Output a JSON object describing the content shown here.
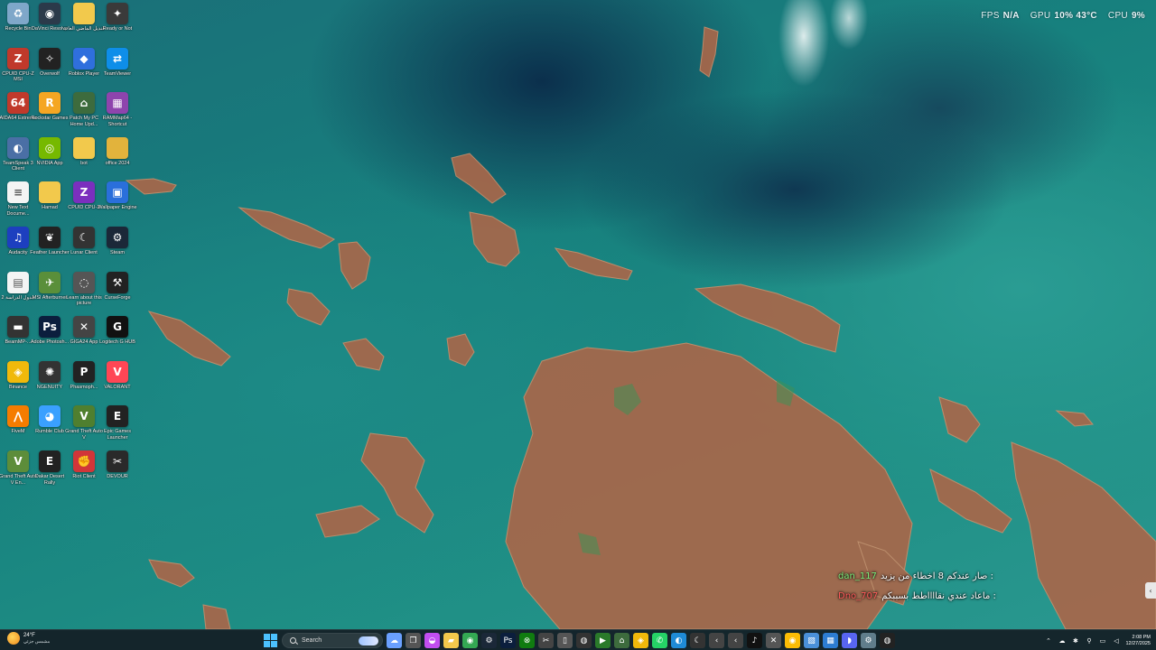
{
  "overlay": {
    "fps_label": "FPS",
    "fps_value": "N/A",
    "gpu_label": "GPU",
    "gpu_value": "10% 43°C",
    "cpu_label": "CPU",
    "cpu_value": "9%"
  },
  "desktop": {
    "icons": [
      {
        "label": "Recycle Bin",
        "icon": "recycle-bin-icon",
        "glyph": "♻",
        "color": "#7fa7c9"
      },
      {
        "label": "DaVinci Resolve",
        "icon": "davinci-resolve-icon",
        "glyph": "◉",
        "color": "#2b3a4a"
      },
      {
        "label": "قنديل الماضي ألعاب",
        "icon": "folder-icon",
        "glyph": "",
        "color": "#f2c94c"
      },
      {
        "label": "Ready or Not",
        "icon": "ready-or-not-icon",
        "glyph": "✦",
        "color": "#3a3a3a"
      },
      {
        "label": "CPUID CPU-Z MSI",
        "icon": "cpu-z-icon",
        "glyph": "Z",
        "color": "#c0392b"
      },
      {
        "label": "Overwolf",
        "icon": "overwolf-icon",
        "glyph": "✧",
        "color": "#222"
      },
      {
        "label": "Roblox Player",
        "icon": "roblox-icon",
        "glyph": "◆",
        "color": "#2f6fdd"
      },
      {
        "label": "TeamViewer",
        "icon": "teamviewer-icon",
        "glyph": "⇄",
        "color": "#0e8ee9"
      },
      {
        "label": "AIDA64 Extreme",
        "icon": "aida64-icon",
        "glyph": "64",
        "color": "#c0392b"
      },
      {
        "label": "Rockstar Games",
        "icon": "rockstar-icon",
        "glyph": "R",
        "color": "#f5a623"
      },
      {
        "label": "Patch My PC Home Upd...",
        "icon": "patch-my-pc-icon",
        "glyph": "⌂",
        "color": "#3d6b3d"
      },
      {
        "label": "RAMMap64 - Shortcut",
        "icon": "rammap-icon",
        "glyph": "▦",
        "color": "#8e44ad"
      },
      {
        "label": "TeamSpeak 3 Client",
        "icon": "teamspeak-icon",
        "glyph": "◐",
        "color": "#4a6fa5"
      },
      {
        "label": "NVIDIA App",
        "icon": "nvidia-icon",
        "glyph": "◎",
        "color": "#76b900"
      },
      {
        "label": "bot",
        "icon": "folder-icon",
        "glyph": "",
        "color": "#f2c94c"
      },
      {
        "label": "office 2024",
        "icon": "folder-icon",
        "glyph": "",
        "color": "#e2b33c"
      },
      {
        "label": "New Text Docume...",
        "icon": "text-document-icon",
        "glyph": "≡",
        "color": "#f4f4f4"
      },
      {
        "label": "Hamad",
        "icon": "folder-icon",
        "glyph": "",
        "color": "#f2c94c"
      },
      {
        "label": "CPUID CPU-Z",
        "icon": "cpu-z-icon",
        "glyph": "Z",
        "color": "#7b2fbe"
      },
      {
        "label": "Wallpaper Engine",
        "icon": "wallpaper-engine-icon",
        "glyph": "▣",
        "color": "#2a6fdb"
      },
      {
        "label": "Audacity",
        "icon": "audacity-icon",
        "glyph": "♫",
        "color": "#1d3fbf"
      },
      {
        "label": "Feather Launcher",
        "icon": "feather-launcher-icon",
        "glyph": "❦",
        "color": "#222"
      },
      {
        "label": "Lunar Client",
        "icon": "lunar-client-icon",
        "glyph": "☾",
        "color": "#333"
      },
      {
        "label": "Steam",
        "icon": "steam-icon",
        "glyph": "⚙",
        "color": "#1b2838"
      },
      {
        "label": "جدول الدراسة 2",
        "icon": "document-icon",
        "glyph": "▤",
        "color": "#f4f4f4"
      },
      {
        "label": "MSI Afterburner",
        "icon": "msi-afterburner-icon",
        "glyph": "✈",
        "color": "#5a8f3a"
      },
      {
        "label": "Learn about this picture",
        "icon": "camera-icon",
        "glyph": "◌",
        "color": "#555"
      },
      {
        "label": "CurseForge",
        "icon": "curseforge-icon",
        "glyph": "⚒",
        "color": "#222"
      },
      {
        "label": "BeamMP-...",
        "icon": "beammp-icon",
        "glyph": "▬",
        "color": "#333"
      },
      {
        "label": "Adobe Photosh...",
        "icon": "photoshop-icon",
        "glyph": "Ps",
        "color": "#0b1e3d"
      },
      {
        "label": "GIGA24 App",
        "icon": "giga-app-icon",
        "glyph": "✕",
        "color": "#444"
      },
      {
        "label": "Logitech G HUB",
        "icon": "logitech-ghub-icon",
        "glyph": "G",
        "color": "#111"
      },
      {
        "label": "Binance",
        "icon": "binance-icon",
        "glyph": "◈",
        "color": "#f0b90b"
      },
      {
        "label": "NGENUITY",
        "icon": "ngenuity-icon",
        "glyph": "✺",
        "color": "#333"
      },
      {
        "label": "Phasmoph...",
        "icon": "phasmophobia-icon",
        "glyph": "P",
        "color": "#222"
      },
      {
        "label": "VALORANT",
        "icon": "valorant-icon",
        "glyph": "V",
        "color": "#ff4655"
      },
      {
        "label": "FiveM",
        "icon": "fivem-icon",
        "glyph": "⋀",
        "color": "#f57c00"
      },
      {
        "label": "Rumble Club",
        "icon": "rumble-club-icon",
        "glyph": "◕",
        "color": "#3aa0ff"
      },
      {
        "label": "Grand Theft Auto V",
        "icon": "gta-v-icon",
        "glyph": "V",
        "color": "#4f7f2f"
      },
      {
        "label": "Epic Games Launcher",
        "icon": "epic-games-icon",
        "glyph": "E",
        "color": "#222"
      },
      {
        "label": "Grand Theft Auto V En...",
        "icon": "gta-v-enhanced-icon",
        "glyph": "V",
        "color": "#5d8d3a"
      },
      {
        "label": "Dakar Desert Rally",
        "icon": "epic-games-icon",
        "glyph": "E",
        "color": "#222"
      },
      {
        "label": "Riot Client",
        "icon": "riot-client-icon",
        "glyph": "✊",
        "color": "#d13639"
      },
      {
        "label": "DEVOUR",
        "icon": "devour-icon",
        "glyph": "✂",
        "color": "#2a2a2a"
      }
    ]
  },
  "chat": {
    "messages": [
      {
        "user": "dan_117",
        "text": "صار عندكم 8 اخطاء من يزيد : "
      },
      {
        "user": "Dno_707",
        "text": "ماعاد عندي نقااااطط بسببكم : "
      }
    ]
  },
  "taskbar": {
    "weather_temp": "24°F",
    "weather_desc": "مشمس جزئي",
    "search_placeholder": "Search",
    "apps": [
      {
        "name": "widgets-icon",
        "glyph": "☁",
        "color": "#6aa0ff"
      },
      {
        "name": "task-view-icon",
        "glyph": "❐",
        "color": "#555"
      },
      {
        "name": "copilot-icon",
        "glyph": "◒",
        "color": "#c24ef0"
      },
      {
        "name": "file-explorer-icon",
        "glyph": "▰",
        "color": "#f2c94c"
      },
      {
        "name": "chrome-icon",
        "glyph": "◉",
        "color": "#34a853"
      },
      {
        "name": "steam-icon",
        "glyph": "⚙",
        "color": "#1b2838"
      },
      {
        "name": "photoshop-icon",
        "glyph": "Ps",
        "color": "#0b1e3d"
      },
      {
        "name": "xbox-icon",
        "glyph": "⊗",
        "color": "#107c10"
      },
      {
        "name": "snipping-tool-icon",
        "glyph": "✂",
        "color": "#444"
      },
      {
        "name": "notepad-icon",
        "glyph": "▯",
        "color": "#555"
      },
      {
        "name": "obs-icon",
        "glyph": "◍",
        "color": "#333"
      },
      {
        "name": "media-player-icon",
        "glyph": "▶",
        "color": "#2a7a2a"
      },
      {
        "name": "patch-my-pc-icon",
        "glyph": "⌂",
        "color": "#3d6b3d"
      },
      {
        "name": "binance-icon",
        "glyph": "◈",
        "color": "#f0b90b"
      },
      {
        "name": "whatsapp-icon",
        "glyph": "✆",
        "color": "#25d366"
      },
      {
        "name": "edge-icon",
        "glyph": "◐",
        "color": "#1e8bd6"
      },
      {
        "name": "lunar-client-icon",
        "glyph": "☾",
        "color": "#333"
      },
      {
        "name": "back-icon",
        "glyph": "‹",
        "color": "#444"
      },
      {
        "name": "forward-icon",
        "glyph": "‹",
        "color": "#444"
      },
      {
        "name": "tiktok-icon",
        "glyph": "♪",
        "color": "#111"
      },
      {
        "name": "gaming-icon",
        "glyph": "✕",
        "color": "#555"
      },
      {
        "name": "chrome-alt-icon",
        "glyph": "◉",
        "color": "#fbbc05"
      },
      {
        "name": "photos-icon",
        "glyph": "▧",
        "color": "#4a90d9"
      },
      {
        "name": "store-icon",
        "glyph": "▦",
        "color": "#2d7dd2"
      },
      {
        "name": "discord-icon",
        "glyph": "◗",
        "color": "#5865f2"
      },
      {
        "name": "settings-icon",
        "glyph": "⚙",
        "color": "#607d8b"
      },
      {
        "name": "obs-studio-icon",
        "glyph": "◍",
        "color": "#222"
      }
    ],
    "tray": [
      {
        "name": "chevron-up-icon",
        "glyph": "⌃"
      },
      {
        "name": "network-icon",
        "glyph": "☁"
      },
      {
        "name": "bluetooth-icon",
        "glyph": "✱"
      },
      {
        "name": "usb-icon",
        "glyph": "⚲"
      },
      {
        "name": "display-icon",
        "glyph": "▭"
      },
      {
        "name": "volume-icon",
        "glyph": "◁"
      }
    ],
    "clock_time": "2:08 PM",
    "clock_date": "12/27/2025"
  }
}
